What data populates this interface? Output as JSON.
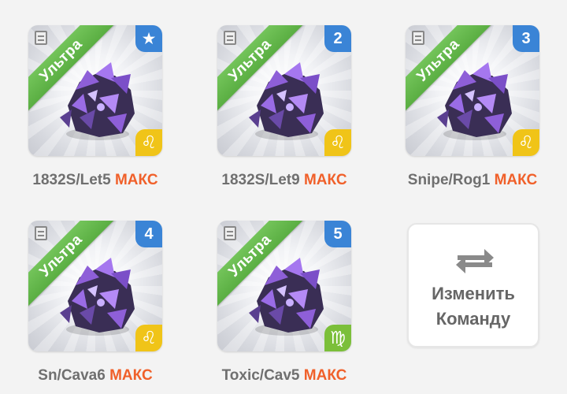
{
  "cards": [
    {
      "tier": "Ультра",
      "slot": "★",
      "slot_icon": "star-icon",
      "zodiac": "♌",
      "zodiac_color": "#f0c418",
      "name": "1832S/Let5",
      "level": "МАКС"
    },
    {
      "tier": "Ультра",
      "slot": "2",
      "slot_icon": "",
      "zodiac": "♌",
      "zodiac_color": "#f0c418",
      "name": "1832S/Let9",
      "level": "МАКС"
    },
    {
      "tier": "Ультра",
      "slot": "3",
      "slot_icon": "",
      "zodiac": "♌",
      "zodiac_color": "#f0c418",
      "name": "Snipe/Rog1",
      "level": "МАКС"
    },
    {
      "tier": "Ультра",
      "slot": "4",
      "slot_icon": "",
      "zodiac": "♌",
      "zodiac_color": "#f0c418",
      "name": "Sn/Cava6",
      "level": "МАКС"
    },
    {
      "tier": "Ультра",
      "slot": "5",
      "slot_icon": "",
      "zodiac": "♍",
      "zodiac_color": "#7bbf3a",
      "name": "Toxic/Cav5",
      "level": "МАКС"
    }
  ],
  "change_team": {
    "line1": "Изменить",
    "line2": "Команду",
    "icon": "swap-arrows-icon"
  },
  "colors": {
    "tier": "#5aae42",
    "slot": "#3a84d6",
    "max": "#f0602a",
    "caption": "#6f6f6f"
  }
}
